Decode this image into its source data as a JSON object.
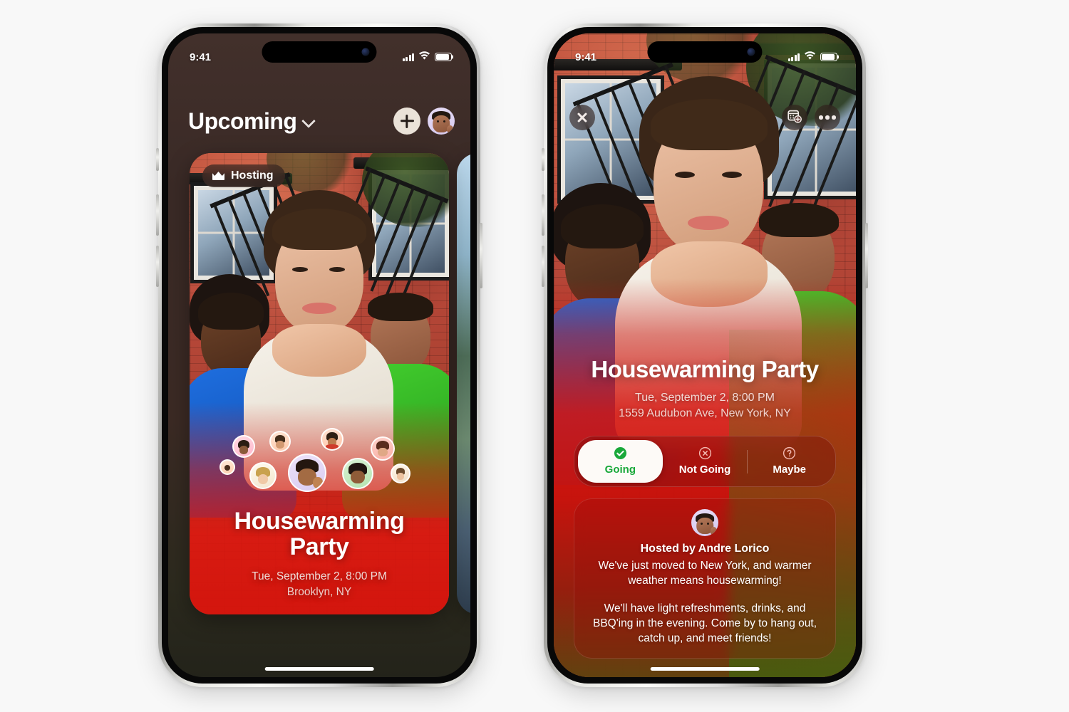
{
  "theme": {
    "page_bg": "#f8f8f8",
    "accent_red": "#d6180f",
    "accent_green": "#19a83a",
    "going_green": "#19a83a",
    "badge_bg": "rgba(58,40,35,.72)"
  },
  "left_phone": {
    "status_bar": {
      "time": "9:41",
      "cellular": "signal-bars",
      "wifi": "wifi-icon",
      "battery": "battery-icon"
    },
    "nav": {
      "title": "Upcoming",
      "chevron": "chevron-down-icon",
      "add_button": "plus-icon",
      "profile": "profile-memoji-avatar"
    },
    "card": {
      "badge": {
        "icon": "crown-icon",
        "label": "Hosting"
      },
      "title": "Housewarming\nParty",
      "title_line1": "Housewarming",
      "title_line2": "Party",
      "date": "Tue, September 2, 8:00 PM",
      "location": "Brooklyn, NY",
      "attendee_count": 9
    },
    "home_indicator": "home-indicator"
  },
  "right_phone": {
    "status_bar": {
      "time": "9:41",
      "cellular": "signal-bars",
      "wifi": "wifi-icon",
      "battery": "battery-icon"
    },
    "nav": {
      "close": "close-icon",
      "add_to_calendar": "calendar-add-icon",
      "more": "ellipsis-icon"
    },
    "event": {
      "title": "Housewarming Party",
      "date": "Tue, September 2, 8:00 PM",
      "address": "1559 Audubon Ave, New York, NY"
    },
    "rsvp": {
      "options": [
        {
          "label": "Going",
          "icon": "check-circle-icon",
          "selected": true
        },
        {
          "label": "Not Going",
          "icon": "x-circle-icon",
          "selected": false
        },
        {
          "label": "Maybe",
          "icon": "question-circle-icon",
          "selected": false
        }
      ]
    },
    "host": {
      "avatar": "host-memoji-avatar",
      "name": "Hosted by Andre Lorico",
      "description": "We've just moved to New York, and warmer weather means housewarming!",
      "description2": "We'll have light refreshments, drinks, and BBQ'ing in the evening. Come by to hang out, catch up, and meet friends!"
    },
    "home_indicator": "home-indicator"
  }
}
